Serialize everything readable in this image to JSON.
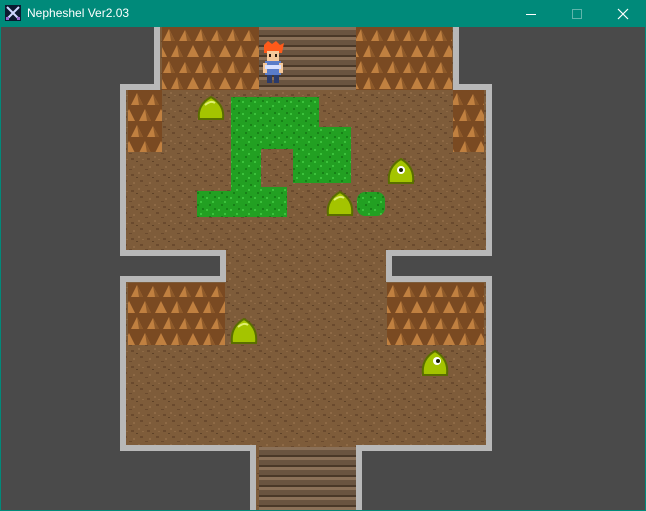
{
  "window": {
    "title": "Nepheshel Ver2.03",
    "icon": "crossed-swords-icon",
    "controls": {
      "minimize": "minimize-icon",
      "maximize": "maximize-icon",
      "close": "close-icon"
    },
    "titlebar_color": "#008a7a"
  },
  "scene": {
    "type": "dungeon-room",
    "player": {
      "name": "hero",
      "hair_color": "#ff5a1a"
    },
    "enemy_count": 5,
    "enemy_color": "#a4c400",
    "floor_color": "#7e5c3a",
    "wall_color": "#b8b8b8",
    "grass_color": "#22a022",
    "void_color": "#4a4a4a"
  }
}
